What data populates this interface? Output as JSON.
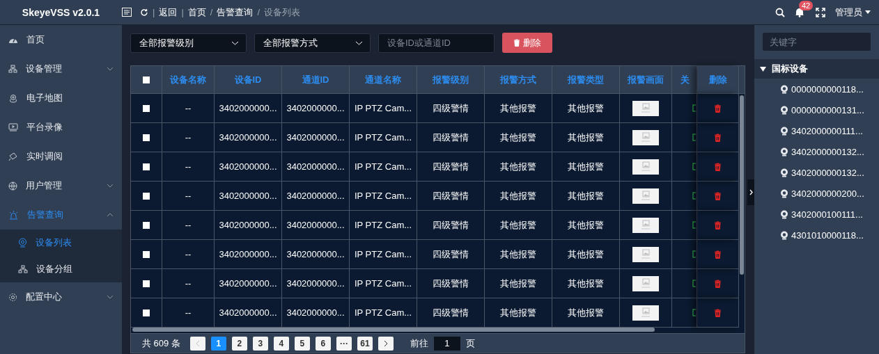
{
  "app": {
    "title": "SkeyeVSS v2.0.1"
  },
  "header": {
    "nav": [
      {
        "kind": "sep",
        "text": "|"
      },
      {
        "kind": "link",
        "text": "返回"
      },
      {
        "kind": "sep",
        "text": "|"
      },
      {
        "kind": "link",
        "text": "首页"
      },
      {
        "kind": "sep",
        "text": "/"
      },
      {
        "kind": "link",
        "text": "告警查询"
      },
      {
        "kind": "sep",
        "text": "/"
      },
      {
        "kind": "current",
        "text": "设备列表"
      }
    ],
    "notifications": "42",
    "user": "管理员"
  },
  "sidebar": {
    "items": [
      {
        "kind": "link",
        "label": "首页",
        "selected": false
      },
      {
        "kind": "group",
        "label": "设备管理",
        "selected": false,
        "expanded": false
      },
      {
        "kind": "link",
        "label": "电子地图",
        "selected": false
      },
      {
        "kind": "link",
        "label": "平台录像",
        "selected": false
      },
      {
        "kind": "link",
        "label": "实时调阅",
        "selected": false
      },
      {
        "kind": "group",
        "label": "用户管理",
        "selected": false,
        "expanded": false
      },
      {
        "kind": "group",
        "label": "告警查询",
        "selected": true,
        "expanded": true,
        "children": [
          {
            "label": "设备列表",
            "selected": true
          },
          {
            "label": "设备分组",
            "selected": false
          }
        ]
      },
      {
        "kind": "group",
        "label": "配置中心",
        "selected": false,
        "expanded": false
      }
    ]
  },
  "filters": [
    {
      "kind": "select",
      "value": "全部报警级别"
    },
    {
      "kind": "select",
      "value": "全部报警方式"
    },
    {
      "kind": "input",
      "placeholder": "设备ID或通道ID"
    }
  ],
  "delete_button": "删除",
  "table": {
    "all_checked": false,
    "columns": [
      "设备名称",
      "设备ID",
      "通道ID",
      "通道名称",
      "报警级别",
      "报警方式",
      "报警类型",
      "报警画面",
      "关",
      "删除"
    ],
    "rows": [
      {
        "checked": false,
        "cells": [
          "--",
          "3402000000...",
          "3402000000...",
          "IP PTZ Cam...",
          "四级警情",
          "其他报警",
          "其他报警"
        ]
      },
      {
        "checked": false,
        "cells": [
          "--",
          "3402000000...",
          "3402000000...",
          "IP PTZ Cam...",
          "四级警情",
          "其他报警",
          "其他报警"
        ]
      },
      {
        "checked": false,
        "cells": [
          "--",
          "3402000000...",
          "3402000000...",
          "IP PTZ Cam...",
          "四级警情",
          "其他报警",
          "其他报警"
        ]
      },
      {
        "checked": false,
        "cells": [
          "--",
          "3402000000...",
          "3402000000...",
          "IP PTZ Cam...",
          "四级警情",
          "其他报警",
          "其他报警"
        ]
      },
      {
        "checked": false,
        "cells": [
          "--",
          "3402000000...",
          "3402000000...",
          "IP PTZ Cam...",
          "四级警情",
          "其他报警",
          "其他报警"
        ]
      },
      {
        "checked": false,
        "cells": [
          "--",
          "3402000000...",
          "3402000000...",
          "IP PTZ Cam...",
          "四级警情",
          "其他报警",
          "其他报警"
        ]
      },
      {
        "checked": false,
        "cells": [
          "--",
          "3402000000...",
          "3402000000...",
          "IP PTZ Cam...",
          "四级警情",
          "其他报警",
          "其他报警"
        ]
      },
      {
        "checked": false,
        "cells": [
          "--",
          "3402000000...",
          "3402000000...",
          "IP PTZ Cam...",
          "四级警情",
          "其他报警",
          "其他报警"
        ]
      }
    ]
  },
  "pagination": {
    "total": "共 609 条",
    "prev_disabled": true,
    "next_disabled": false,
    "pages": [
      {
        "label": "1",
        "selected": true
      },
      {
        "label": "2",
        "selected": false
      },
      {
        "label": "3",
        "selected": false
      },
      {
        "label": "4",
        "selected": false
      },
      {
        "label": "5",
        "selected": false
      },
      {
        "label": "6",
        "selected": false
      },
      {
        "label": "···",
        "selected": false
      },
      {
        "label": "61",
        "selected": false
      }
    ],
    "goto_label": "前往",
    "goto_value": "1",
    "goto_unit": "页"
  },
  "device_tree": {
    "search_placeholder": "关键字",
    "root": {
      "label": "国标设备",
      "expanded": true,
      "children": [
        {
          "label": "0000000000118..."
        },
        {
          "label": "0000000000131..."
        },
        {
          "label": "3402000000111..."
        },
        {
          "label": "3402000000132..."
        },
        {
          "label": "3402000000132..."
        },
        {
          "label": "3402000000200..."
        },
        {
          "label": "3402000100111..."
        },
        {
          "label": "4301010000118..."
        }
      ]
    }
  }
}
